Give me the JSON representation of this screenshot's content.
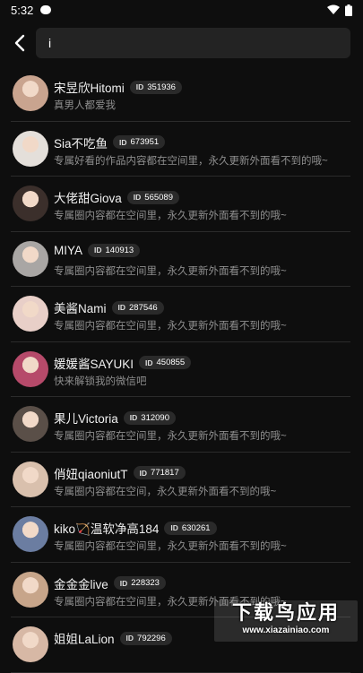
{
  "status_bar": {
    "time": "5:32"
  },
  "search": {
    "value": "i",
    "placeholder": ""
  },
  "results": [
    {
      "name": "宋昱欣Hitomi",
      "id_label": "ID",
      "id": "351936",
      "desc": "真男人都爱我",
      "avatar_color": "#c9a48f"
    },
    {
      "name": "Sia不吃鱼",
      "id_label": "ID",
      "id": "673951",
      "desc": "专属好看的作品内容都在空间里，永久更新外面看不到的哦~",
      "avatar_color": "#e4dfda"
    },
    {
      "name": "大佬甜Giova",
      "id_label": "ID",
      "id": "565089",
      "desc": "专属圈内容都在空间里，永久更新外面看不到的哦~",
      "avatar_color": "#3b2f2b"
    },
    {
      "name": "MIYA",
      "id_label": "ID",
      "id": "140913",
      "desc": "专属圈内容都在空间里，永久更新外面看不到的哦~",
      "avatar_color": "#a9a6a4"
    },
    {
      "name": "美酱Nami",
      "id_label": "ID",
      "id": "287546",
      "desc": "专属圈内容都在空间里，永久更新外面看不到的哦~",
      "avatar_color": "#e8cfc8"
    },
    {
      "name": "媛媛酱SAYUKI",
      "id_label": "ID",
      "id": "450855",
      "desc": "快来解锁我的微信吧",
      "avatar_color": "#b64a6a"
    },
    {
      "name": "果儿Victoria",
      "id_label": "ID",
      "id": "312090",
      "desc": "专属圈内容都在空间里，永久更新外面看不到的哦~",
      "avatar_color": "#5a4f48"
    },
    {
      "name": "俏妞qiaoniutT",
      "id_label": "ID",
      "id": "771817",
      "desc": "专属圈内容都在空间，永久更新外面看不到的哦~",
      "avatar_color": "#d9c0ad"
    },
    {
      "name": "kiko🏹温软净高184",
      "id_label": "ID",
      "id": "630261",
      "desc": "专属圈内容都在空间里，永久更新外面看不到的哦~",
      "avatar_color": "#6b7da1"
    },
    {
      "name": "金金金live",
      "id_label": "ID",
      "id": "228323",
      "desc": "专属圈内容都在空间里，永久更新外面看不到的哦~",
      "avatar_color": "#c7a58a"
    },
    {
      "name": "姐姐LaLion",
      "id_label": "ID",
      "id": "792296",
      "desc": "",
      "avatar_color": "#d7b8a5"
    }
  ],
  "watermark": {
    "main": "下载鸟应用",
    "sub": "www.xiazainiao.com"
  }
}
